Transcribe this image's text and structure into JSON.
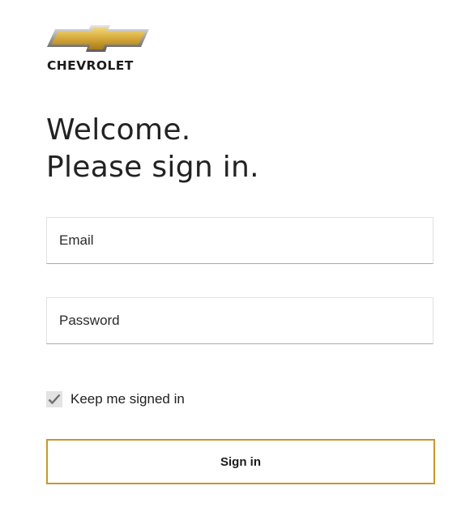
{
  "brand": {
    "logo_text": "CHEVROLET",
    "bowtie_color": "#d4a93a"
  },
  "headline": {
    "line1": "Welcome.",
    "line2": "Please sign in."
  },
  "form": {
    "email_placeholder": "Email",
    "password_placeholder": "Password",
    "keep_signed_in_label": "Keep me signed in",
    "keep_signed_in_checked": true,
    "submit_label": "Sign in"
  },
  "colors": {
    "accent": "#c9972a",
    "text": "#222222",
    "field_border": "#a9a9a9"
  }
}
